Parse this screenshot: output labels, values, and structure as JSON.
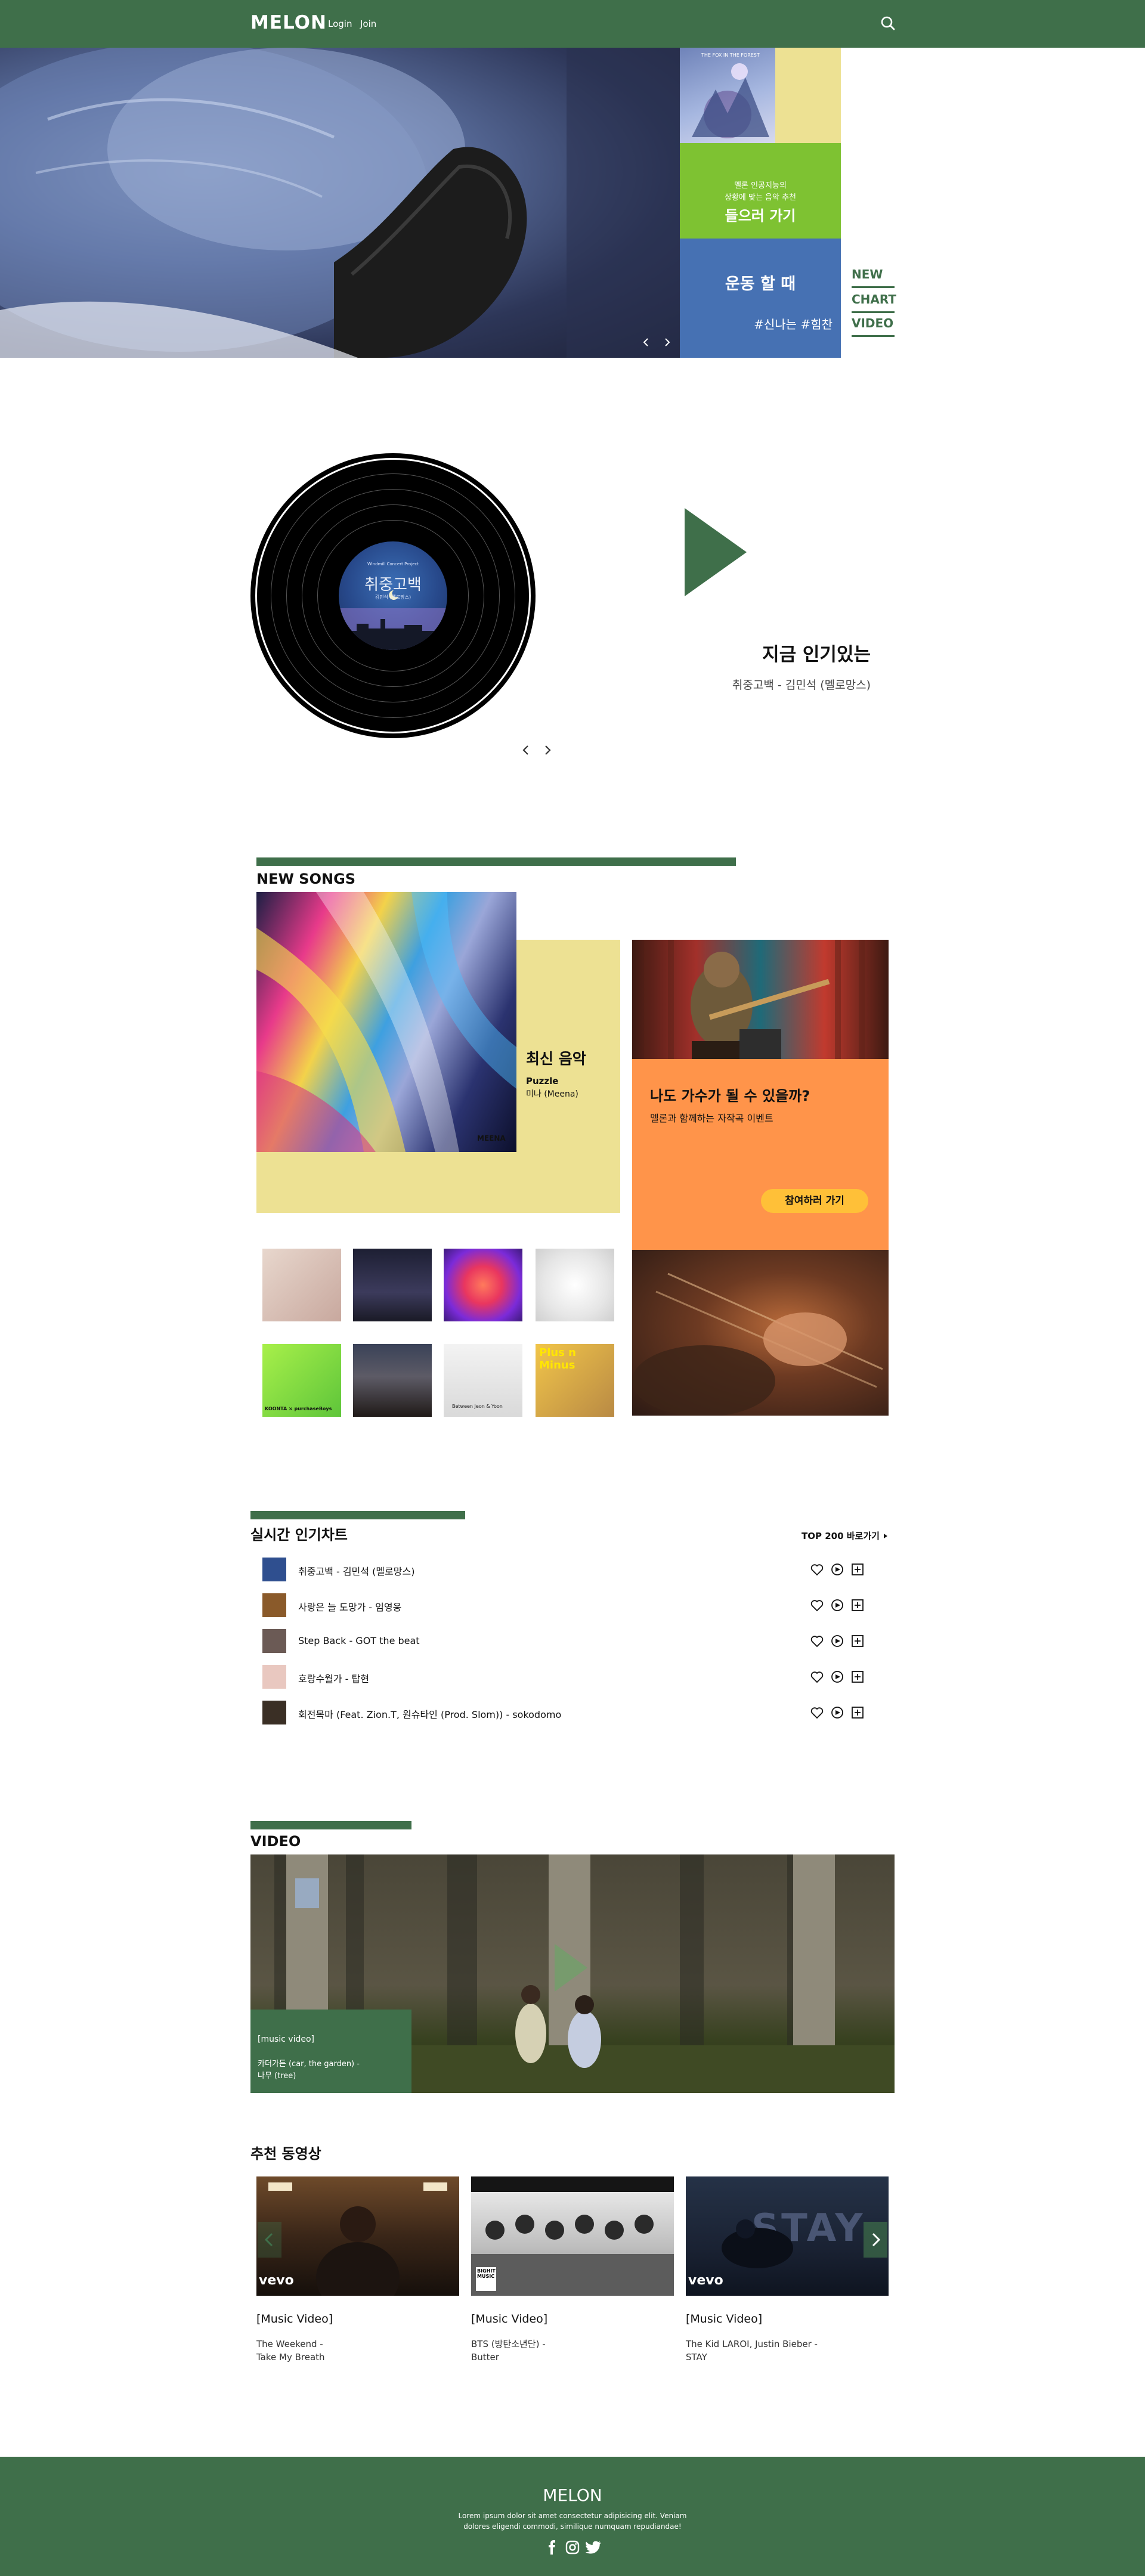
{
  "header": {
    "logo": "MELON",
    "nav": [
      "Login",
      "Join"
    ]
  },
  "hero": {
    "green_small": "멜론 인공지능의",
    "green_small2": "상황에 맞는 음악 추천",
    "green_big": "들으러 가기",
    "blue_title": "운동 할 때",
    "blue_tags": "#신나는 #힘찬",
    "sublinks": [
      "NEW",
      "CHART",
      "VIDEO"
    ],
    "cover_text": "THE FOX IN THE FOREST"
  },
  "now": {
    "label_top": "Windmill Concert Project",
    "label_title": "취중고백",
    "label_sub": "김민석 (멜로망스)",
    "title": "지금 인기있는",
    "subtitle": "취중고백 - 김민석 (멜로망스)"
  },
  "new_songs": {
    "title": "NEW SONGS",
    "feature_title": "최신 음악",
    "feature_song": "Puzzle",
    "feature_artist": "미나 (Meena)",
    "cover_tag": "MEENA",
    "event_title": "나도 가수가 될 수 있을까?",
    "event_sub": "멜론과 함께하는 자작곡 이벤트",
    "event_button": "참여하러 가기",
    "thumb_texts": [
      "KOONTA × purchaseBoys",
      "Between Jeon & Yoon",
      "Plus n Minus"
    ]
  },
  "chart": {
    "title": "실시간 인기차트",
    "top200": "TOP 200 바로가기",
    "rows": [
      {
        "text": "취중고백 - 김민석 (멜로망스)",
        "color": "#2f4f8f"
      },
      {
        "text": "사랑은 늘 도망가 - 임영웅",
        "color": "#8a5a2a"
      },
      {
        "text": "Step Back - GOT the beat",
        "color": "#6b5a55"
      },
      {
        "text": "호랑수월가 - 탑현",
        "color": "#e9c8c0"
      },
      {
        "text": "회전목마 (Feat. Zion.T, 원슈타인 (Prod. Slom)) - sokodomo",
        "color": "#3a2f25"
      }
    ]
  },
  "video": {
    "title": "VIDEO",
    "caption_tag": "[music video]",
    "caption_line1": "카더가든 (car, the garden) -",
    "caption_line2": "나무 (tree)"
  },
  "recommended": {
    "title": "추천 동영상",
    "cards": [
      {
        "label": "[Music Video]",
        "line1": "The Weekend -",
        "line2": "Take My Breath",
        "tag": "vevo"
      },
      {
        "label": "[Music Video]",
        "line1": "BTS (방탄소년단) -",
        "line2": "Butter",
        "tag": "BIGHIT MUSIC"
      },
      {
        "label": "[Music Video]",
        "line1": "The Kid LAROI, Justin Bieber -",
        "line2": "STAY",
        "tag": "vevo"
      }
    ],
    "stay_text": "STAY"
  },
  "footer": {
    "title": "MELON",
    "line1": "Lorem ipsum dolor sit amet consectetur adipisicing elit. Veniam",
    "line2": "dolores eligendi commodi, similique numquam repudiandae!"
  },
  "colors": {
    "brand_green": "#3f6f4a",
    "hero_green": "#7ec232",
    "hero_blue": "#4671b3",
    "yellow": "#ede193",
    "orange": "#ff944a",
    "button_yellow": "#ffc038"
  },
  "icons": [
    "search-icon",
    "play-icon",
    "chevron-left-icon",
    "chevron-right-icon",
    "heart-icon",
    "play-circle-icon",
    "add-box-icon",
    "facebook-icon",
    "instagram-icon",
    "twitter-icon",
    "arrow-right-icon"
  ]
}
